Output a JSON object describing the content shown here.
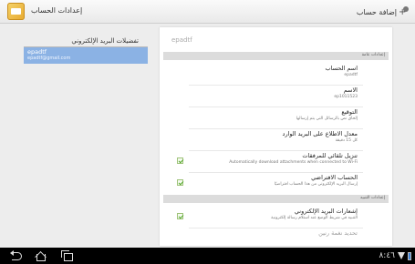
{
  "topbar": {
    "title": "إعدادات الحساب",
    "add_account_label": "إضافة حساب"
  },
  "left_pane": {
    "header": "تفضيلات البريد الإلكتروني",
    "account_name": "epadtf",
    "account_email": "epadtf@gmail.com"
  },
  "right_pane": {
    "title": "epadtf",
    "general_header": "إعدادات عامة",
    "notifications_header": "إعدادات التنبيه",
    "rows": [
      {
        "title": "اسم الحساب",
        "subtitle": "epadtf"
      },
      {
        "title": "الاسم",
        "subtitle": "ep1011523"
      },
      {
        "title": "التوقيع",
        "subtitle": "إلحاق نص بالرسائل التي يتم إرسالها"
      },
      {
        "title": "معدل الاطلاع على البريد الوارد",
        "subtitle": "كل 15 دقيقة"
      },
      {
        "title": "تنزيل تلقائي للمرفقات",
        "subtitle": "Automatically download attachments when connected to Wi-Fi",
        "checked": true
      },
      {
        "title": "الحساب الافتراضي",
        "subtitle": "إرسال البريد الإلكتروني من هذا الحساب افتراضيًا",
        "checked": true
      },
      {
        "title": "إشعارات البريد الإلكتروني",
        "subtitle": "التنبيه في شريط الوضع عند استلام رسالة إلكترونية",
        "checked": true
      },
      {
        "title": "تحديد نغمة رنين"
      }
    ]
  },
  "statusbar": {
    "clock": "٨:٤٦"
  },
  "icons": {
    "app": "email-app-icon",
    "add_account": "add-account-icon",
    "back": "back-icon",
    "home": "home-icon",
    "recent": "recent-apps-icon",
    "wifi": "wifi-icon",
    "battery": "battery-icon"
  },
  "colors": {
    "selection": "#8bb2e4",
    "checkbox_green": "#52a62a",
    "section_header": "#dcdcdc"
  }
}
